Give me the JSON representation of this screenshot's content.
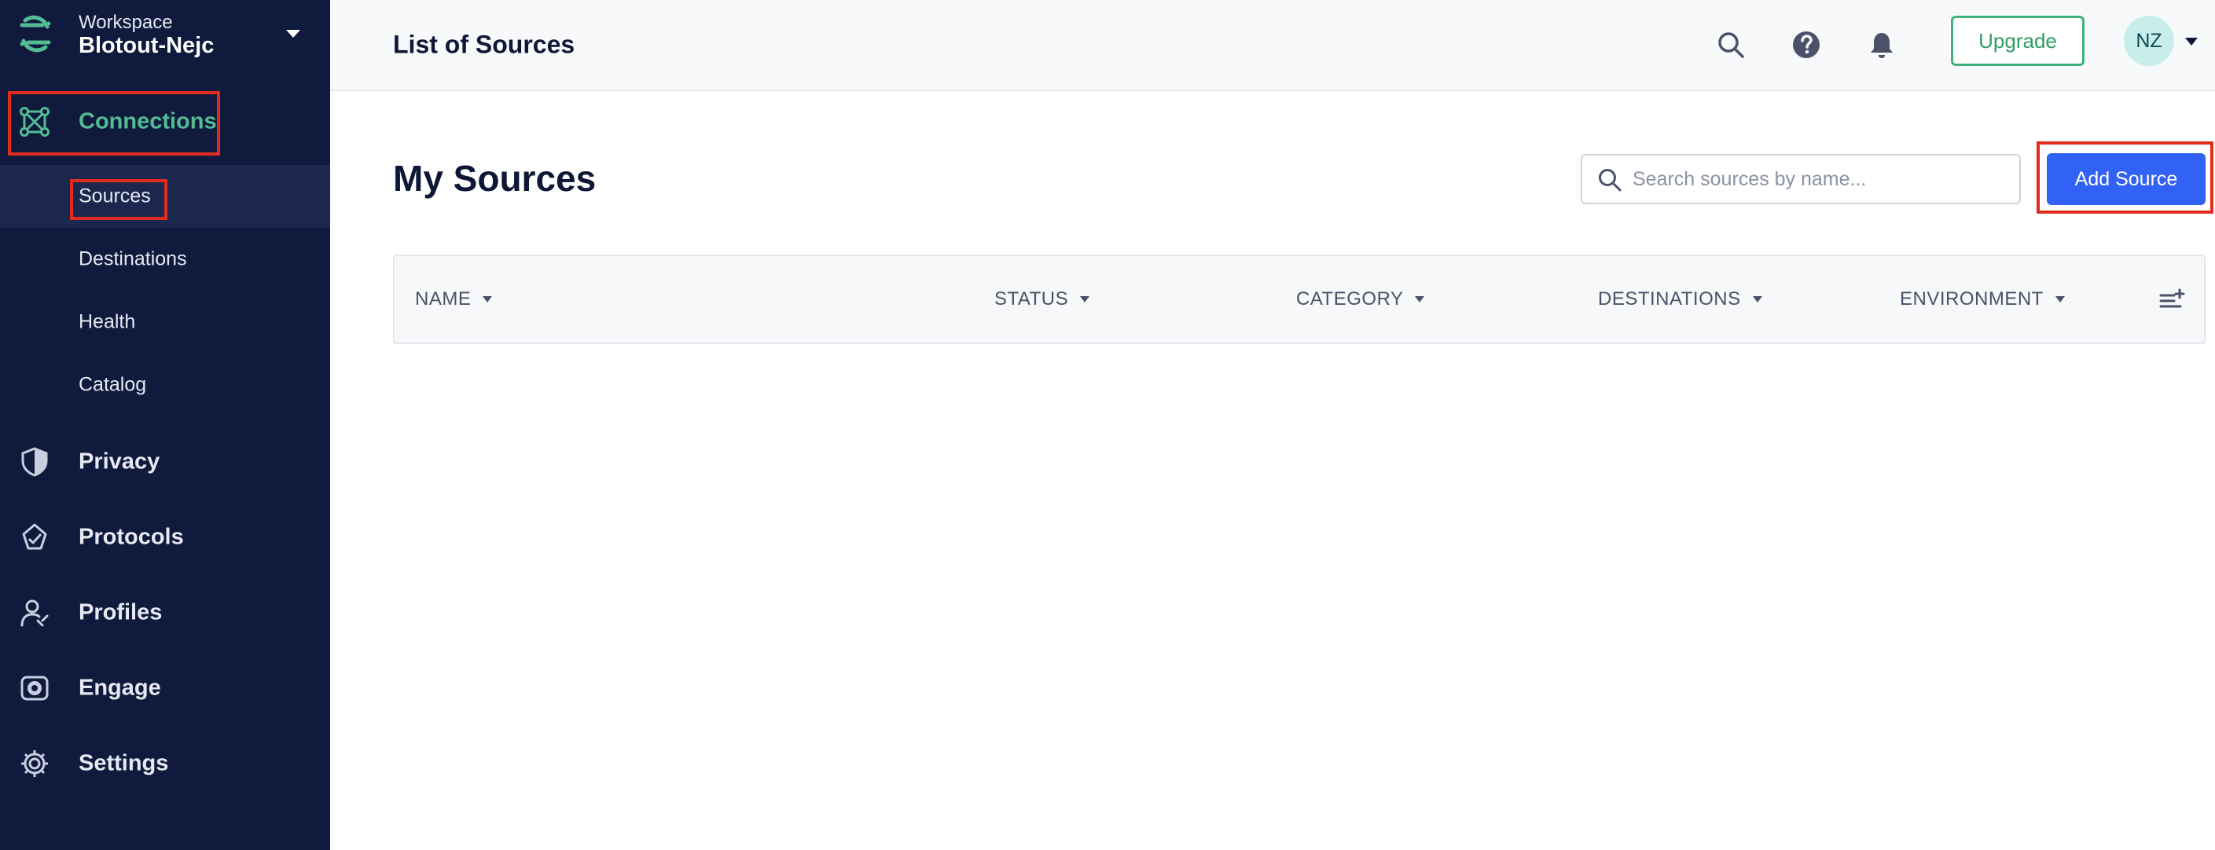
{
  "workspace": {
    "label": "Workspace",
    "name": "Blotout-Nejc"
  },
  "sidebar": {
    "connections": {
      "label": "Connections",
      "icon": "connections-icon"
    },
    "subitems": [
      {
        "label": "Sources",
        "active": true
      },
      {
        "label": "Destinations",
        "active": false
      },
      {
        "label": "Health",
        "active": false
      },
      {
        "label": "Catalog",
        "active": false
      }
    ],
    "items": [
      {
        "label": "Privacy",
        "icon": "shield-icon"
      },
      {
        "label": "Protocols",
        "icon": "protocols-icon"
      },
      {
        "label": "Profiles",
        "icon": "profiles-icon"
      },
      {
        "label": "Engage",
        "icon": "engage-icon"
      },
      {
        "label": "Settings",
        "icon": "gear-icon"
      }
    ]
  },
  "header": {
    "title": "List of Sources",
    "upgrade_label": "Upgrade",
    "avatar_initials": "NZ"
  },
  "main": {
    "title": "My Sources",
    "search_placeholder": "Search sources by name...",
    "add_button_label": "Add Source",
    "columns": [
      "NAME",
      "STATUS",
      "CATEGORY",
      "DESTINATIONS",
      "ENVIRONMENT"
    ]
  },
  "colors": {
    "sidebar_bg": "#0f1a3c",
    "accent_green": "#52bd94",
    "primary_blue": "#3162f5",
    "highlight_red": "#e02b1d"
  }
}
